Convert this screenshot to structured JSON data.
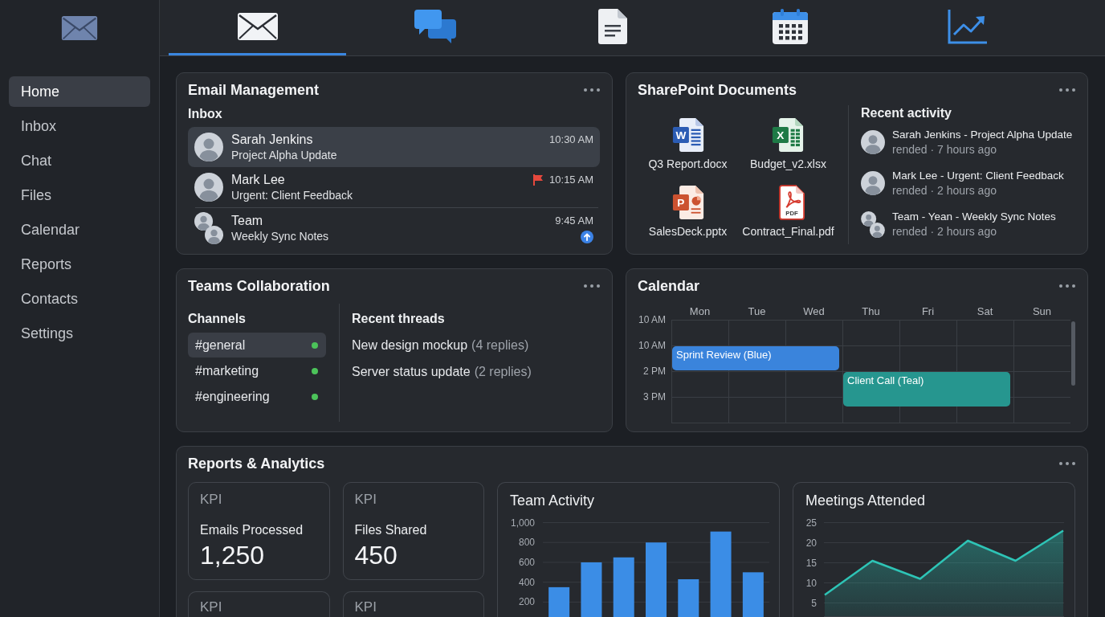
{
  "sidebar": {
    "items": [
      {
        "label": "Home",
        "selected": true
      },
      {
        "label": "Inbox",
        "selected": false
      },
      {
        "label": "Chat",
        "selected": false
      },
      {
        "label": "Files",
        "selected": false
      },
      {
        "label": "Calendar",
        "selected": false
      },
      {
        "label": "Reports",
        "selected": false
      },
      {
        "label": "Contacts",
        "selected": false
      },
      {
        "label": "Settings",
        "selected": false
      }
    ]
  },
  "top_tabs": [
    {
      "kind": "mail",
      "selected": true
    },
    {
      "kind": "chat",
      "selected": false
    },
    {
      "kind": "document",
      "selected": false
    },
    {
      "kind": "calendar",
      "selected": false
    },
    {
      "kind": "chart",
      "selected": false
    }
  ],
  "email_card": {
    "title": "Email Management",
    "section": "Inbox",
    "messages": [
      {
        "sender": "Sarah Jenkins",
        "subject": "Project Alpha Update",
        "time": "10:30 AM",
        "kind": "person",
        "selected": true,
        "flagged": false,
        "badge": false
      },
      {
        "sender": "Mark Lee",
        "subject": "Urgent: Client Feedback",
        "time": "10:15 AM",
        "kind": "person",
        "selected": false,
        "flagged": true,
        "badge": false
      },
      {
        "sender": "Team",
        "subject": "Weekly Sync Notes",
        "time": "9:45 AM",
        "kind": "group",
        "selected": false,
        "flagged": false,
        "badge": true
      }
    ]
  },
  "documents_card": {
    "title": "SharePoint Documents",
    "files": [
      {
        "name": "Q3 Report.docx",
        "kind": "document",
        "icon_text": "W"
      },
      {
        "name": "Budget_v2.xlsx",
        "kind": "spreadsheet",
        "icon_text": "X"
      },
      {
        "name": "SalesDeck.pptx",
        "kind": "presentation",
        "icon_text": "P"
      },
      {
        "name": "Contract_Final.pdf",
        "kind": "pdf",
        "icon_text": "PDF"
      }
    ],
    "activity_title": "Recent activity",
    "activity": [
      {
        "title": "Sarah Jenkins - Project Alpha Update",
        "meta": "rended · 7 hours ago",
        "kind": "person"
      },
      {
        "title": "Mark Lee - Urgent: Client Feedback",
        "meta": "rended · 2 hours ago",
        "kind": "person"
      },
      {
        "title": "Team - Yean - Weekly Sync Notes",
        "meta": "rended · 2 hours ago",
        "kind": "group"
      }
    ]
  },
  "teams_card": {
    "title": "Teams Collaboration",
    "channels_title": "Channels",
    "channels": [
      {
        "name": "#general",
        "selected": true,
        "unread": true
      },
      {
        "name": "#marketing",
        "selected": false,
        "unread": true
      },
      {
        "name": "#engineering",
        "selected": false,
        "unread": true
      }
    ],
    "threads_title": "Recent threads",
    "threads": [
      {
        "title": "New design mockup",
        "replies": "(4 replies)"
      },
      {
        "title": "Server status update",
        "replies": "(2 replies)"
      }
    ]
  },
  "calendar_card": {
    "title": "Calendar",
    "days": [
      "Mon",
      "Tue",
      "Wed",
      "Thu",
      "Fri",
      "Sat",
      "Sun"
    ],
    "rows": [
      {
        "time": "10 AM"
      },
      {
        "time": "10 AM",
        "events": [
          {
            "title": "Sprint Review (Blue)",
            "color": "#3a84dc"
          }
        ]
      },
      {
        "time": "2 PM",
        "events": [
          {
            "title": "Client Call (Teal)",
            "color": "#26968f"
          }
        ]
      },
      {
        "time": "3 PM"
      }
    ]
  },
  "reports_card": {
    "title": "Reports & Analytics",
    "kpis": [
      {
        "label": "KPI",
        "title": "Emails Processed",
        "value": "1,250"
      },
      {
        "label": "KPI",
        "title": "Files Shared",
        "value": "450"
      },
      {
        "label": "KPI"
      },
      {
        "label": "KPI"
      }
    ],
    "charts": [
      {
        "chart_data": {
          "type": "bar",
          "title": "Team Activity",
          "values": [
            350,
            600,
            650,
            800,
            430,
            910,
            500
          ],
          "ylim": [
            50,
            1000
          ],
          "yticks": [
            200,
            400,
            600,
            800,
            {
              "value": 1000,
              "label": "1,000"
            }
          ],
          "grid": true
        }
      },
      {
        "chart_data": {
          "type": "area",
          "title": "Meetings Attended",
          "values": [
            7,
            15.5,
            11,
            20.5,
            15.5,
            23
          ],
          "ylim": [
            1.5,
            25
          ],
          "yticks": [
            5,
            10,
            15,
            20,
            25
          ],
          "grid": true
        }
      }
    ]
  }
}
